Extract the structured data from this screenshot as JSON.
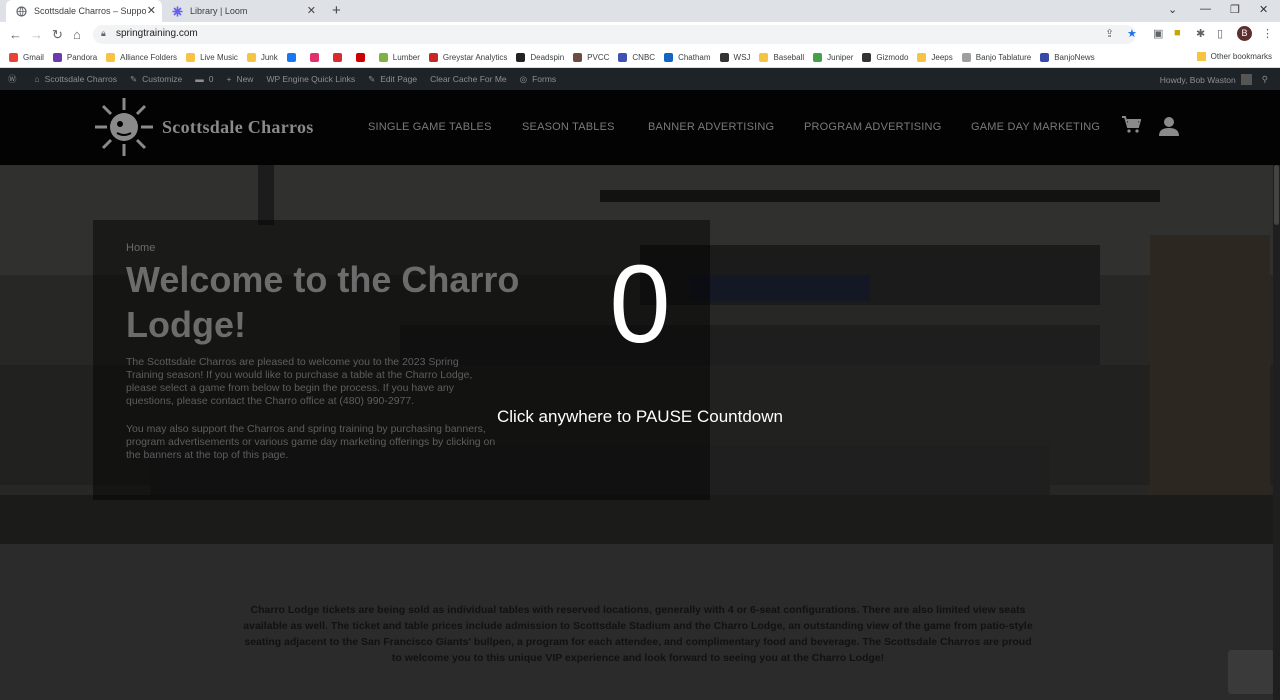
{
  "browser": {
    "tabs": [
      {
        "title": "Scottsdale Charros – Supporting",
        "active": true
      },
      {
        "title": "Library | Loom",
        "active": false
      }
    ],
    "url": "springtraining.com",
    "profile_initial": "B",
    "bookmarks": [
      {
        "label": "Gmail",
        "color": "#ea4335"
      },
      {
        "label": "Pandora",
        "color": "#6a3bb0"
      },
      {
        "label": "Alliance Folders",
        "color": "#f6c343"
      },
      {
        "label": "Live Music",
        "color": "#f6c343"
      },
      {
        "label": "Junk",
        "color": "#f6c343"
      },
      {
        "label": "",
        "color": "#1877f2"
      },
      {
        "label": "",
        "color": "#e1306c"
      },
      {
        "label": "",
        "color": "#d82c2c"
      },
      {
        "label": "",
        "color": "#cc0000"
      },
      {
        "label": "Lumber",
        "color": "#7cb342"
      },
      {
        "label": "Greystar Analytics",
        "color": "#c62828"
      },
      {
        "label": "Deadspin",
        "color": "#222"
      },
      {
        "label": "PVCC",
        "color": "#6d4c41"
      },
      {
        "label": "CNBC",
        "color": "#3f51b5"
      },
      {
        "label": "Chatham",
        "color": "#1565c0"
      },
      {
        "label": "WSJ",
        "color": "#333"
      },
      {
        "label": "Baseball",
        "color": "#f6c343"
      },
      {
        "label": "Juniper",
        "color": "#43a047"
      },
      {
        "label": "Gizmodo",
        "color": "#333"
      },
      {
        "label": "Jeeps",
        "color": "#f6c343"
      },
      {
        "label": "Banjo Tablature",
        "color": "#9e9e9e"
      },
      {
        "label": "BanjoNews",
        "color": "#3949ab"
      }
    ],
    "other_bookmarks": "Other bookmarks"
  },
  "wpbar": {
    "site": "Scottsdale Charros",
    "customize": "Customize",
    "comments": "0",
    "new": "New",
    "quicklinks": "WP Engine Quick Links",
    "edit": "Edit Page",
    "cache": "Clear Cache For Me",
    "forms": "Forms",
    "howdy": "Howdy, Bob Waston"
  },
  "site": {
    "logo": "Scottsdale Charros",
    "nav": [
      "SINGLE GAME TABLES",
      "SEASON TABLES",
      "BANNER ADVERTISING",
      "PROGRAM ADVERTISING",
      "GAME DAY MARKETING"
    ]
  },
  "hero": {
    "breadcrumb": "Home",
    "title": "Welcome to the Charro Lodge!",
    "p1": "The Scottsdale Charros are pleased to welcome you to the 2023 Spring Training season! If you would like to purchase a table at the Charro Lodge, please select a game from below to begin the process. If you have any questions, please contact the Charro office at (480) 990-2977.",
    "p2": "You may also support the Charros and spring training by purchasing banners, program advertisements or various game day marketing offerings by clicking on the banners at the top of this page."
  },
  "countdown": {
    "value": "0",
    "message": "Click anywhere to PAUSE Countdown"
  },
  "intro": "Charro Lodge tickets are being sold as individual tables with reserved locations, generally with 4 or 6-seat configurations. There are also limited view seats available as well. The ticket and table prices include admission to Scottsdale Stadium and the Charro Lodge, an outstanding view of the game from patio-style seating adjacent to the San Francisco Giants' bullpen, a program for each attendee, and complimentary food and beverage. The Scottsdale Charros are proud to welcome you to this unique VIP experience and look forward to seeing you at the Charro Lodge!"
}
